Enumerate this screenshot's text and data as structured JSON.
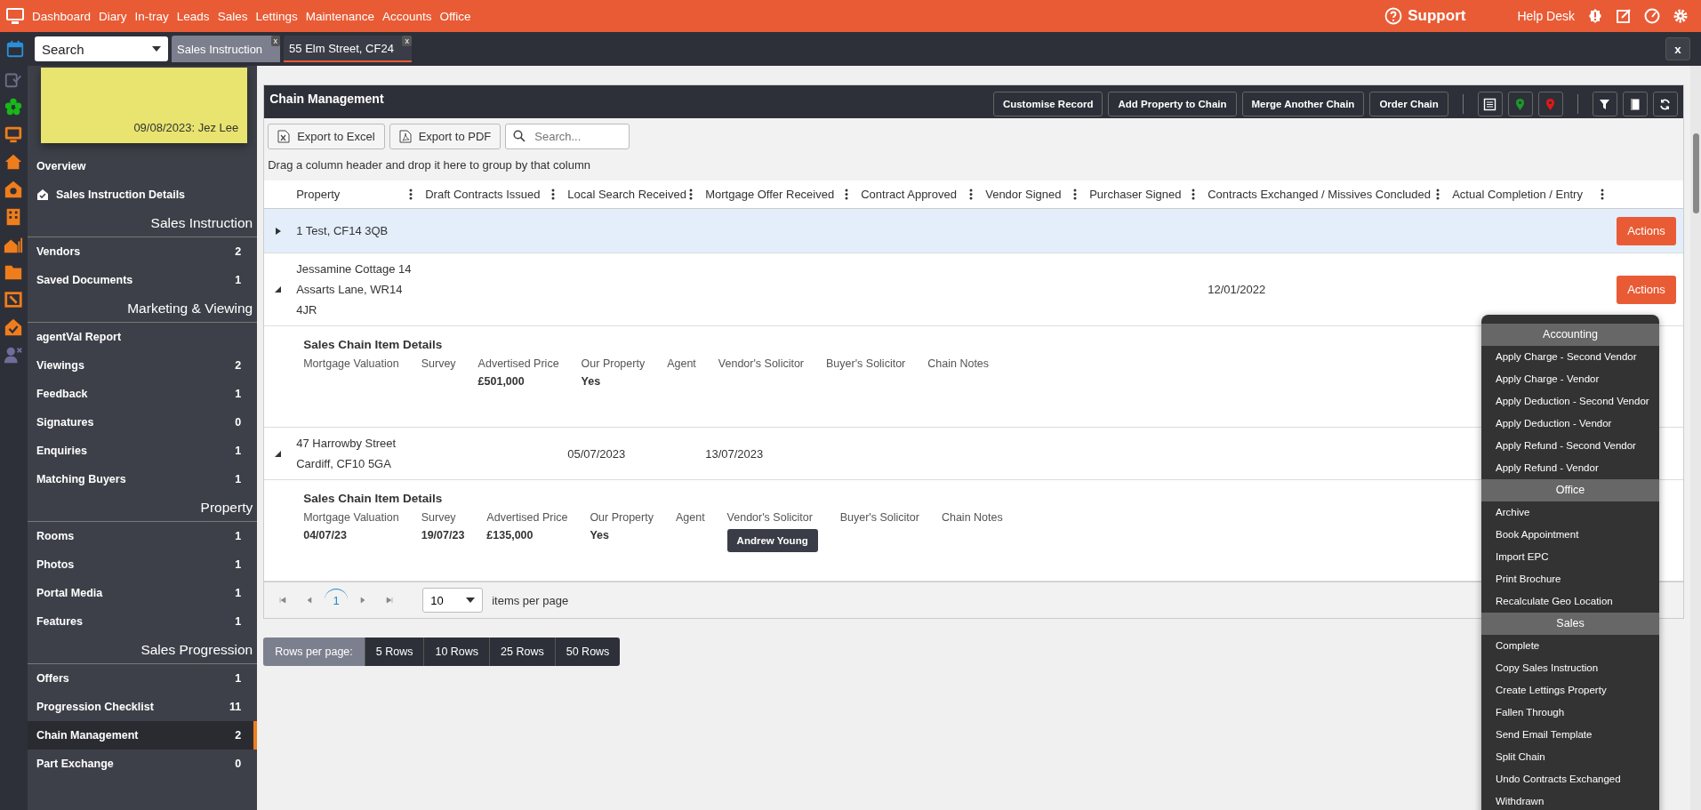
{
  "top_nav": {
    "items": [
      "Dashboard",
      "Diary",
      "In-tray",
      "Leads",
      "Sales",
      "Lettings",
      "Maintenance",
      "Accounts",
      "Office"
    ],
    "support": "Support",
    "help_desk": "Help Desk"
  },
  "tab_bar": {
    "search": {
      "value": "Search"
    },
    "tabs": [
      {
        "label": "Sales Instruction",
        "close": "x",
        "selected": false
      },
      {
        "label": "55 Elm Street, CF24",
        "close": "x",
        "selected": true
      }
    ],
    "close_all": "x"
  },
  "sidebar": {
    "note": {
      "text": "09/08/2023: Jez Lee"
    },
    "items": [
      {
        "kind": "link",
        "label": "Overview"
      },
      {
        "kind": "icon_link",
        "label": "Sales Instruction Details"
      },
      {
        "kind": "heading",
        "label": "Sales Instruction"
      },
      {
        "kind": "item",
        "label": "Vendors",
        "count": "2",
        "selected": false
      },
      {
        "kind": "item",
        "label": "Saved Documents",
        "count": "1",
        "selected": false
      },
      {
        "kind": "heading",
        "label": "Marketing & Viewing"
      },
      {
        "kind": "link",
        "label": "agentVal Report"
      },
      {
        "kind": "item",
        "label": "Viewings",
        "count": "2",
        "selected": false
      },
      {
        "kind": "item",
        "label": "Feedback",
        "count": "1",
        "selected": false
      },
      {
        "kind": "item",
        "label": "Signatures",
        "count": "0",
        "selected": false
      },
      {
        "kind": "item",
        "label": "Enquiries",
        "count": "1",
        "selected": false
      },
      {
        "kind": "item",
        "label": "Matching Buyers",
        "count": "1",
        "selected": false
      },
      {
        "kind": "heading",
        "label": "Property"
      },
      {
        "kind": "item",
        "label": "Rooms",
        "count": "1",
        "selected": false
      },
      {
        "kind": "item",
        "label": "Photos",
        "count": "1",
        "selected": false
      },
      {
        "kind": "item",
        "label": "Portal Media",
        "count": "1",
        "selected": false
      },
      {
        "kind": "item",
        "label": "Features",
        "count": "1",
        "selected": false
      },
      {
        "kind": "heading",
        "label": "Sales Progression"
      },
      {
        "kind": "item",
        "label": "Offers",
        "count": "1",
        "selected": false
      },
      {
        "kind": "item",
        "label": "Progression Checklist",
        "count": "11",
        "selected": false
      },
      {
        "kind": "item",
        "label": "Chain Management",
        "count": "2",
        "selected": true
      },
      {
        "kind": "item",
        "label": "Part Exchange",
        "count": "0",
        "selected": false
      }
    ]
  },
  "panel": {
    "title": "Chain Management",
    "header_buttons": [
      "Customise Record",
      "Add Property to Chain",
      "Merge Another Chain",
      "Order Chain"
    ],
    "toolbar": {
      "buttons": [
        "Export to Excel",
        "Export to PDF"
      ],
      "search_placeholder": "Search..."
    },
    "group_hint": "Drag a column header and drop it here to group by that column",
    "columns": [
      "Property",
      "Draft Contracts Issued",
      "Local Search Received",
      "Mortgage Offer Received",
      "Contract Approved",
      "Vendor Signed",
      "Purchaser Signed",
      "Contracts Exchanged / Missives Concluded",
      "Actual Completion / Entry"
    ],
    "rows": [
      {
        "cells": [
          "1 Test, CF14 3QB",
          "",
          "",
          "",
          "",
          "",
          "",
          "",
          ""
        ],
        "selected": true,
        "expanded": false,
        "action": "Actions"
      },
      {
        "cells": [
          "Jessamine Cottage 14 Assarts Lane, WR14 4JR",
          "",
          "",
          "",
          "",
          "",
          "",
          "12/01/2022",
          ""
        ],
        "selected": false,
        "expanded": true,
        "action": "Actions",
        "detail": {
          "title": "Sales Chain Item Details",
          "fields": [
            {
              "label": "Mortgage Valuation",
              "kind": "text"
            },
            {
              "label": "Survey",
              "kind": "text"
            },
            {
              "label": "Advertised Price",
              "value": "£501,000",
              "kind": "text"
            },
            {
              "label": "Our Property",
              "value": "Yes",
              "kind": "text"
            },
            {
              "label": "Agent",
              "kind": "text"
            },
            {
              "label": "Vendor's Solicitor",
              "kind": "text"
            },
            {
              "label": "Buyer's Solicitor",
              "kind": "text"
            },
            {
              "label": "Chain Notes",
              "kind": "text"
            }
          ]
        }
      },
      {
        "cells": [
          "47 Harrowby Street Cardiff, CF10 5GA",
          "",
          "05/07/2023",
          "13/07/2023",
          "",
          "",
          "",
          "",
          ""
        ],
        "selected": false,
        "expanded": true,
        "detail": {
          "title": "Sales Chain Item Details",
          "fields": [
            {
              "label": "Mortgage Valuation",
              "value": "04/07/23",
              "kind": "text"
            },
            {
              "label": "Survey",
              "value": "19/07/23",
              "kind": "text"
            },
            {
              "label": "Advertised Price",
              "value": "£135,000",
              "kind": "text"
            },
            {
              "label": "Our Property",
              "value": "Yes",
              "kind": "text"
            },
            {
              "label": "Agent",
              "kind": "text"
            },
            {
              "label": "Vendor's Solicitor",
              "value": "Andrew Young",
              "kind": "chip"
            },
            {
              "label": "Buyer's Solicitor",
              "kind": "text"
            },
            {
              "label": "Chain Notes",
              "kind": "text"
            }
          ]
        }
      }
    ],
    "pager": {
      "pages": [
        {
          "label": "1",
          "selected": true
        }
      ],
      "page_size": "10",
      "page_size_label": "items per page"
    }
  },
  "rows_per_page": {
    "label": "Rows per page:",
    "options": [
      "5 Rows",
      "10 Rows",
      "25 Rows",
      "50 Rows"
    ]
  },
  "actions_menu": {
    "groups": [
      {
        "title": "Accounting",
        "items": [
          "Apply Charge - Second Vendor",
          "Apply Charge - Vendor",
          "Apply Deduction - Second Vendor",
          "Apply Deduction - Vendor",
          "Apply Refund - Second Vendor",
          "Apply Refund - Vendor"
        ]
      },
      {
        "title": "Office",
        "items": [
          "Archive",
          "Book Appointment",
          "Import EPC",
          "Print Brochure",
          "Recalculate Geo Location"
        ]
      },
      {
        "title": "Sales",
        "items": [
          "Complete",
          "Copy Sales Instruction",
          "Create Lettings Property",
          "Fallen Through",
          "Send Email Template",
          "Split Chain",
          "Undo Contracts Exchanged",
          "Withdrawn"
        ]
      }
    ]
  }
}
